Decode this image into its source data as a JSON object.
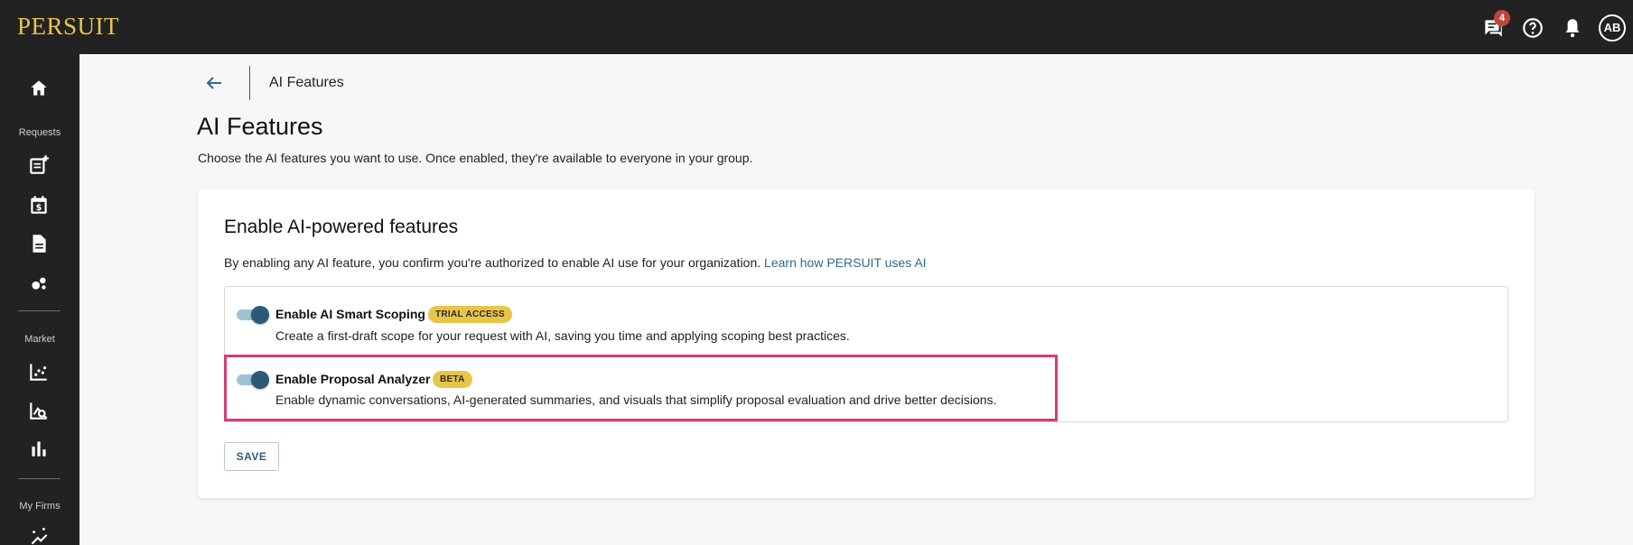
{
  "app": {
    "logo": "PERSUIT"
  },
  "topbar": {
    "message_count": "4",
    "avatar_initials": "AB"
  },
  "sidebar": {
    "sections": {
      "requests": "Requests",
      "market": "Market",
      "my_firms": "My Firms"
    }
  },
  "breadcrumb": {
    "current": "AI Features"
  },
  "page": {
    "title": "AI Features",
    "description": "Choose the AI features you want to use. Once enabled, they're available to everyone in your group."
  },
  "card": {
    "title": "Enable AI-powered features",
    "description": "By enabling any AI feature, you confirm you're authorized to enable AI use for your organization.",
    "link": "Learn how PERSUIT uses AI"
  },
  "features": [
    {
      "title": "Enable AI Smart Scoping",
      "badge": "TRIAL ACCESS",
      "description": "Create a first-draft scope for your request with AI, saving you time and applying scoping best practices.",
      "enabled": true
    },
    {
      "title": "Enable Proposal Analyzer",
      "badge": "BETA",
      "description": "Enable dynamic conversations, AI-generated summaries, and visuals that simplify proposal evaluation and drive better decisions.",
      "enabled": true
    }
  ],
  "actions": {
    "save": "SAVE"
  },
  "colors": {
    "accent": "#e8c547",
    "highlight": "#d63b78",
    "link": "#2e6b8a",
    "toggle_thumb": "#2a5a78"
  }
}
